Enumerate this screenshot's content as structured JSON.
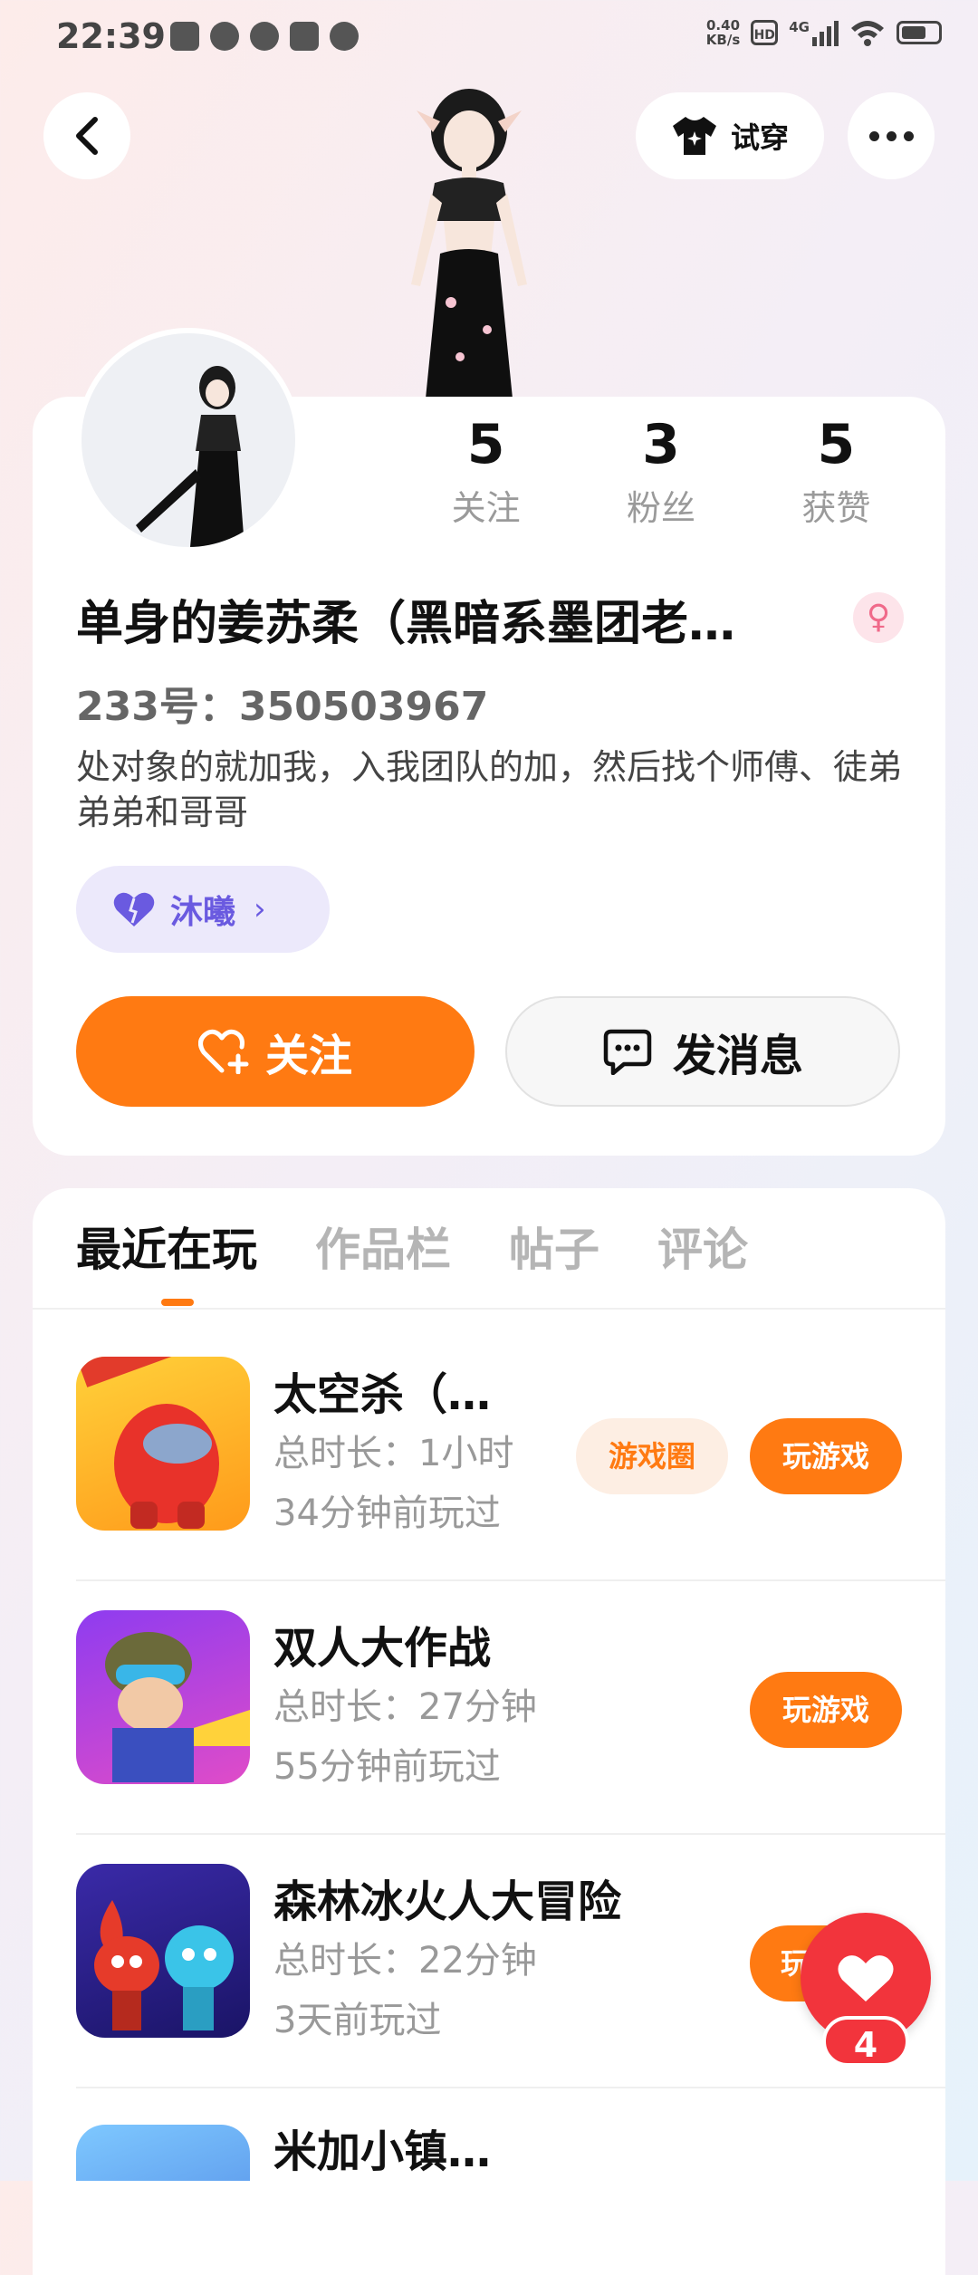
{
  "status_bar": {
    "time": "22:39",
    "net_speed_value": "0.40",
    "net_speed_unit": "KB/s",
    "hd": "HD",
    "network": "4G",
    "icons_left": [
      "card-icon",
      "check-icon",
      "wechat-icon",
      "mail-icon",
      "cloud-icon"
    ]
  },
  "header": {
    "try_on_label": "试穿"
  },
  "profile": {
    "stats": [
      {
        "num": "5",
        "label": "关注"
      },
      {
        "num": "3",
        "label": "粉丝"
      },
      {
        "num": "5",
        "label": "获赞"
      }
    ],
    "name": "单身的姜苏柔（黑暗系墨团老…",
    "gender_symbol": "♀",
    "uid": "233号：350503967",
    "bio": "处对象的就加我，入我团队的加，然后找个师傅、徒弟 弟弟和哥哥",
    "tag_label": "沐曦",
    "follow_label": "关注",
    "message_label": "发消息"
  },
  "tabs": [
    "最近在玩",
    "作品栏",
    "帖子",
    "评论"
  ],
  "games": [
    {
      "name": "太空杀（…",
      "duration": "总时长：1小时",
      "last_played": "34分钟前玩过",
      "circle_label": "游戏圈",
      "play_label": "玩游戏"
    },
    {
      "name": "双人大作战",
      "duration": "总时长：27分钟",
      "last_played": "55分钟前玩过",
      "play_label": "玩游戏"
    },
    {
      "name": "森林冰火人大冒险",
      "duration": "总时长：22分钟",
      "last_played": "3天前玩过",
      "play_label": "玩"
    },
    {
      "name": "米加小镇…"
    }
  ],
  "float_like": {
    "count": "4"
  },
  "colors": {
    "accent": "#ff7a12",
    "like_red": "#f2343c",
    "tag_purple": "#6a5ae0"
  }
}
